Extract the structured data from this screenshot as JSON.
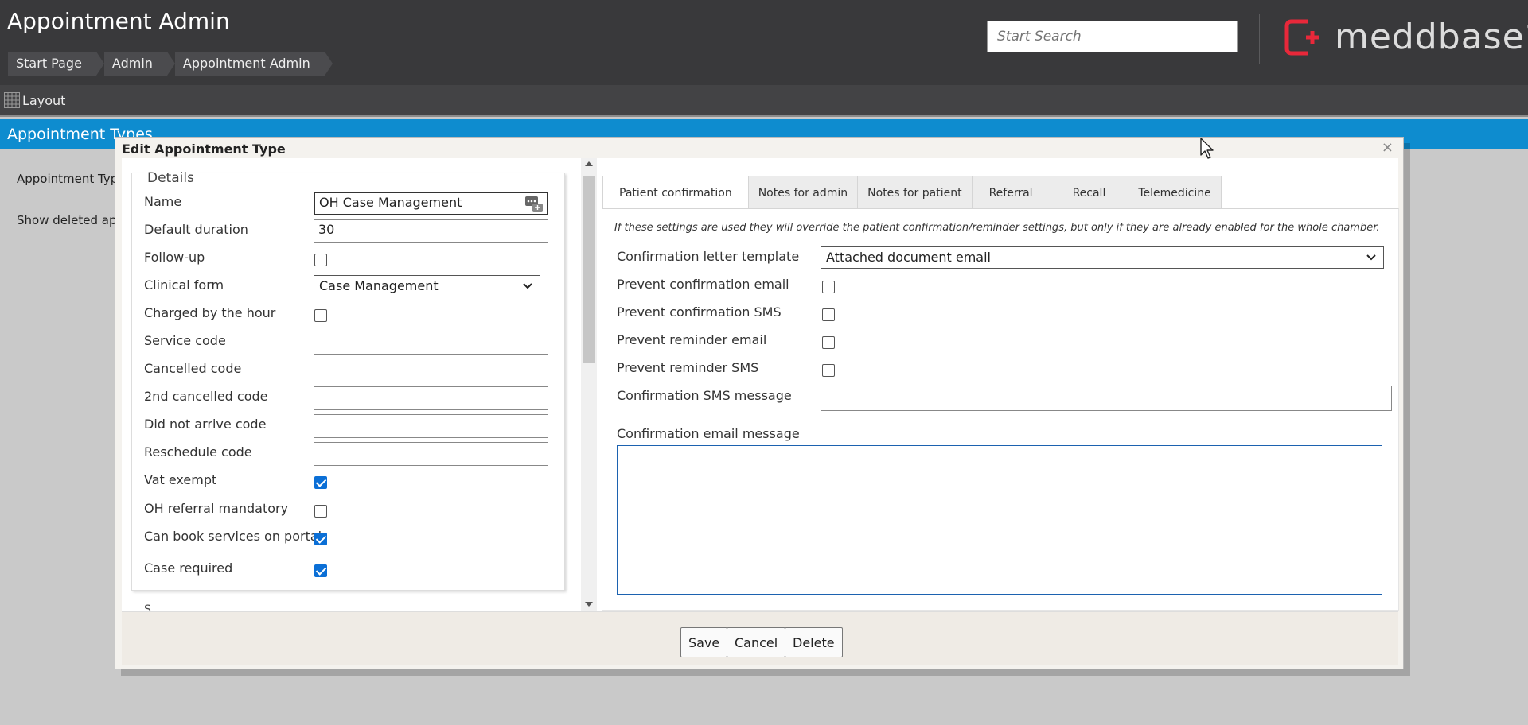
{
  "header": {
    "title": "Appointment Admin",
    "breadcrumbs": [
      "Start Page",
      "Admin",
      "Appointment Admin"
    ],
    "search_placeholder": "Start Search",
    "brand": "meddbase",
    "brand_reg": "®"
  },
  "layout_bar": {
    "label": "Layout"
  },
  "background": {
    "section_title": "Appointment Types",
    "filter_label": "Appointment Type",
    "show_deleted_label": "Show deleted appo"
  },
  "modal": {
    "title": "Edit Appointment Type",
    "close": "×",
    "details": {
      "legend": "Details",
      "name_label": "Name",
      "name_value": "OH Case Management",
      "default_duration_label": "Default duration",
      "default_duration_value": "30",
      "follow_up_label": "Follow-up",
      "clinical_form_label": "Clinical form",
      "clinical_form_value": "Case Management",
      "charged_by_hour_label": "Charged by the hour",
      "service_code_label": "Service code",
      "cancelled_code_label": "Cancelled code",
      "second_cancelled_code_label": "2nd cancelled code",
      "did_not_arrive_code_label": "Did not arrive code",
      "reschedule_code_label": "Reschedule code",
      "vat_exempt_label": "Vat exempt",
      "oh_referral_label": "OH referral mandatory",
      "book_portal_label": "Can book services on portal",
      "case_required_label": "Case required",
      "next_section_partial": "S"
    },
    "tabs": [
      "Patient confirmation",
      "Notes for admin",
      "Notes for patient",
      "Referral",
      "Recall",
      "Telemedicine"
    ],
    "confirmation": {
      "info": "If these settings are used they will override the patient confirmation/reminder settings, but only if they are already enabled for the whole chamber.",
      "letter_template_label": "Confirmation letter template",
      "letter_template_value": "Attached document email",
      "prevent_email_label": "Prevent confirmation email",
      "prevent_sms_label": "Prevent confirmation SMS",
      "prevent_reminder_email_label": "Prevent reminder email",
      "prevent_reminder_sms_label": "Prevent reminder SMS",
      "sms_message_label": "Confirmation SMS message",
      "email_message_label": "Confirmation email message"
    },
    "footer": {
      "save": "Save",
      "cancel": "Cancel",
      "delete": "Delete"
    }
  },
  "colors": {
    "header_bg": "#39393b",
    "section_blue": "#0e8ccf",
    "brand_red": "#e8283a",
    "checkbox_blue": "#0b6fd6"
  }
}
